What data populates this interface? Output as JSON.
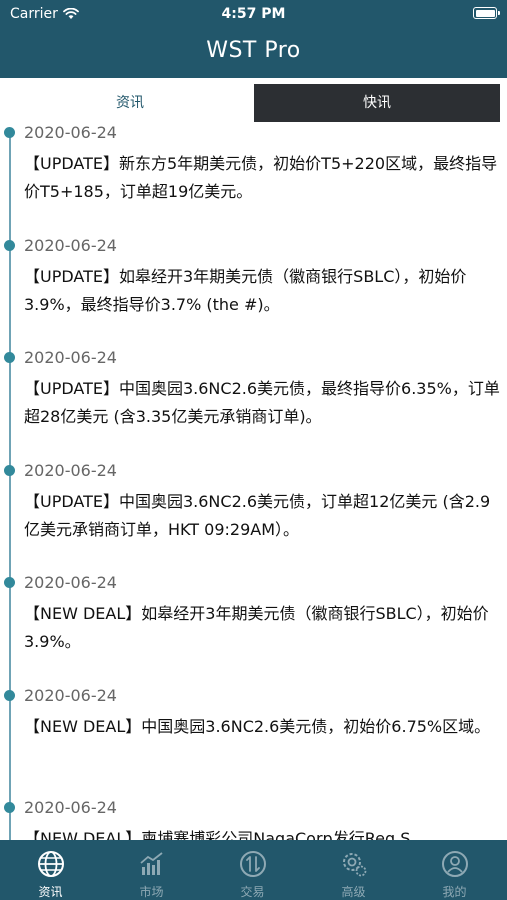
{
  "status_bar": {
    "carrier": "Carrier",
    "time": "4:57 PM"
  },
  "app_title": "WST Pro",
  "top_tabs": [
    {
      "label": "资讯",
      "active": true
    },
    {
      "label": "快讯",
      "active": false
    }
  ],
  "feed": [
    {
      "date": "2020-06-24",
      "text": "【UPDATE】新东方5年期美元债，初始价T5+220区域，最终指导价T5+185，订单超19亿美元。"
    },
    {
      "date": "2020-06-24",
      "text": "【UPDATE】如皋经开3年期美元债（徽商银行SBLC），初始价3.9%，最终指导价3.7% (the #)。"
    },
    {
      "date": "2020-06-24",
      "text": "【UPDATE】中国奥园3.6NC2.6美元债，最终指导价6.35%，订单超28亿美元 (含3.35亿美元承销商订单)。"
    },
    {
      "date": "2020-06-24",
      "text": "【UPDATE】中国奥园3.6NC2.6美元债，订单超12亿美元 (含2.9亿美元承销商订单，HKT 09:29AM）。"
    },
    {
      "date": "2020-06-24",
      "text": "【NEW DEAL】如皋经开3年期美元债（徽商银行SBLC），初始价3.9%。"
    },
    {
      "date": "2020-06-24",
      "text": "【NEW DEAL】中国奥园3.6NC2.6美元债，初始价6.75%区域。"
    },
    {
      "date": "2020-06-24",
      "text": "【NEW DEAL】柬埔寨博彩公司NagaCorp发行Reg S"
    }
  ],
  "bottom_tabs": [
    {
      "label": "资讯",
      "icon": "globe-icon",
      "active": true
    },
    {
      "label": "市场",
      "icon": "bar-chart-icon",
      "active": false
    },
    {
      "label": "交易",
      "icon": "exchange-icon",
      "active": false
    },
    {
      "label": "高级",
      "icon": "gear-advanced-icon",
      "active": false
    },
    {
      "label": "我的",
      "icon": "user-profile-icon",
      "active": false
    }
  ],
  "colors": {
    "header": "#22576b",
    "accent": "#32899b",
    "tab_active_dark": "#2c2f33",
    "tab_inactive_label": "#8ea9b4"
  }
}
